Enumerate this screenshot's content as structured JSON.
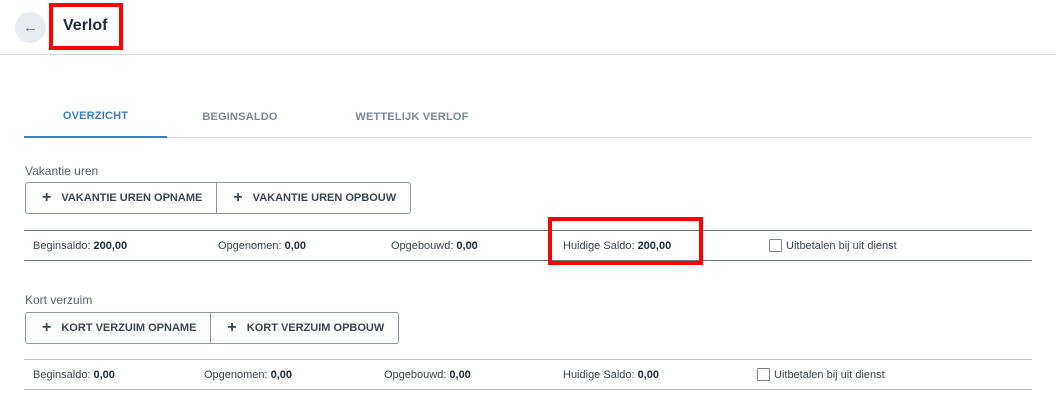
{
  "header": {
    "back_icon": "arrow-left-icon",
    "title": "Verlof"
  },
  "tabs": [
    {
      "label": "OVERZICHT",
      "active": true
    },
    {
      "label": "BEGINSALDO",
      "active": false
    },
    {
      "label": "WETTELIJK VERLOF",
      "active": false
    }
  ],
  "vakantie": {
    "label": "Vakantie uren",
    "buttons": [
      "VAKANTIE UREN OPNAME",
      "VAKANTIE UREN OPBOUW"
    ],
    "beginsaldo_label": "Beginsaldo:",
    "beginsaldo_value": "200,00",
    "opgenomen_label": "Opgenomen:",
    "opgenomen_value": "0,00",
    "opgebouwd_label": "Opgebouwd:",
    "opgebouwd_value": "0,00",
    "saldo_label": "Huidige Saldo:",
    "saldo_value": "200,00",
    "checkbox_label": "Uitbetalen bij uit dienst",
    "checkbox_checked": false
  },
  "kort": {
    "label": "Kort verzuim",
    "buttons": [
      "KORT VERZUIM OPNAME",
      "KORT VERZUIM OPBOUW"
    ],
    "beginsaldo_label": "Beginsaldo:",
    "beginsaldo_value": "0,00",
    "opgenomen_label": "Opgenomen:",
    "opgenomen_value": "0,00",
    "opgebouwd_label": "Opgebouwd:",
    "opgebouwd_value": "0,00",
    "saldo_label": "Huidige Saldo:",
    "saldo_value": "0,00",
    "checkbox_label": "Uitbetalen bij uit dienst",
    "checkbox_checked": false
  },
  "colors": {
    "accent": "#3d7ec7",
    "highlight": "#ff0000"
  }
}
